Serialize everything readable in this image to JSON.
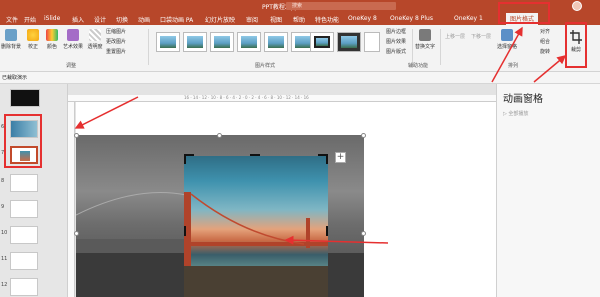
{
  "window": {
    "title": "PPT教程2.pptx -",
    "search_placeholder": "搜索"
  },
  "menu": {
    "tabs": [
      {
        "label": "文件"
      },
      {
        "label": "开始"
      },
      {
        "label": "iSlide"
      },
      {
        "label": "插入"
      },
      {
        "label": "设计"
      },
      {
        "label": "切换"
      },
      {
        "label": "动画"
      },
      {
        "label": "口袋动画 PA"
      },
      {
        "label": "幻灯片放映"
      },
      {
        "label": "审阅"
      },
      {
        "label": "视图"
      },
      {
        "label": "帮助"
      },
      {
        "label": "特色功能"
      },
      {
        "label": "OneKey 8"
      },
      {
        "label": "OneKey 8 Plus"
      },
      {
        "label": "OneKey 1"
      },
      {
        "label": "图片格式"
      }
    ]
  },
  "ribbon": {
    "buttons": {
      "remove_bg": "删除背景",
      "corrections": "校正",
      "color": "颜色",
      "artistic": "艺术效果",
      "transparency": "透明度",
      "compress": "压缩图片",
      "change": "更改图片",
      "reset": "重置图片",
      "border": "图片边框",
      "effects": "图片效果",
      "layout": "图片版式",
      "alt_text": "替换文字",
      "bring_forward": "上移一层",
      "send_backward": "下移一层",
      "selection_pane": "选择窗格",
      "align": "对齐",
      "group": "组合",
      "rotate": "旋转",
      "crop": "裁剪"
    },
    "groups": {
      "adjust": "调整",
      "styles": "图片样式",
      "accessibility": "辅助功能",
      "arrange": "排列"
    }
  },
  "toolbar2": {
    "left_text": "已裁取演示"
  },
  "ruler": {
    "ticks": "16 · 14 · 12 · 10 · 8 · 6 · 4 · 2 · 0 · 2 · 4 · 6 · 8 · 10 · 12 · 14 · 16"
  },
  "thumbnails": [
    {
      "num": "6"
    },
    {
      "num": "7"
    },
    {
      "num": "8"
    },
    {
      "num": "9"
    },
    {
      "num": "10"
    },
    {
      "num": "11"
    },
    {
      "num": "12"
    }
  ],
  "animation_pane": {
    "title": "动画窗格",
    "play_button": "▷ 全部播放"
  },
  "colors": {
    "accent": "#b7472a",
    "annotation_red": "#e53030"
  }
}
